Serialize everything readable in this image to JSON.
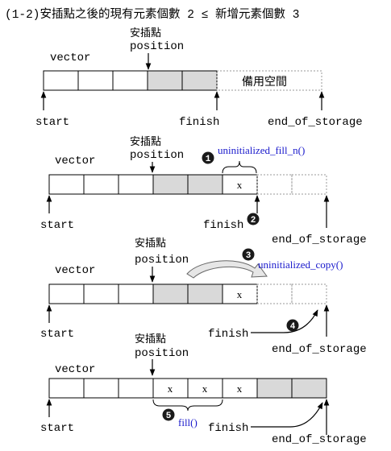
{
  "title": "(1-2)安插點之後的現有元素個數 2 ≤ 新增元素個數 3",
  "labels": {
    "vector": "vector",
    "position_cjk": "安插點",
    "position": "position",
    "start": "start",
    "finish": "finish",
    "end_of_storage": "end_of_storage",
    "spare_space": "備用空間",
    "x": "x"
  },
  "steps": [
    {
      "number": "1",
      "label": "uninitialized_fill_n()"
    },
    {
      "number": "2",
      "label": ""
    },
    {
      "number": "3",
      "label": "uninitialized_copy()"
    },
    {
      "number": "4",
      "label": ""
    },
    {
      "number": "5",
      "label": "fill()"
    }
  ],
  "colors": {
    "shaded_cell": "#d9d9d9",
    "step_badge": "#1a1a1a",
    "function_text": "#1a1acc",
    "line": "#000000",
    "dashed": "#999999"
  }
}
